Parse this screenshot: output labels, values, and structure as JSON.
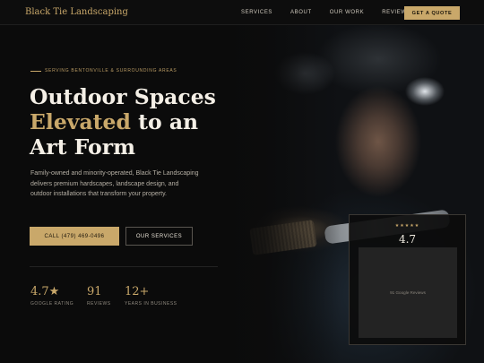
{
  "nav": {
    "brand": "Black Tie Landscaping",
    "links": [
      "SERVICES",
      "ABOUT",
      "OUR WORK",
      "REVIEWS"
    ],
    "cta": "GET A QUOTE"
  },
  "hero": {
    "eyebrow": "SERVING BENTONVILLE & SURROUNDING AREAS",
    "headline_line1": "Outdoor Spaces",
    "headline_gold": "Elevated",
    "headline_line2_rest": " to an",
    "headline_line3": "Art Form",
    "description": "Family-owned and minority-operated, Black Tie Landscaping delivers premium hardscapes, landscape design, and outdoor installations that transform your property.",
    "primary_button": "CALL (479) 469-0496",
    "secondary_button": "OUR SERVICES"
  },
  "stats": [
    {
      "value": "4.7★",
      "label": "GOOGLE RATING"
    },
    {
      "value": "91",
      "label": "REVIEWS"
    },
    {
      "value": "12+",
      "label": "YEARS IN BUSINESS"
    }
  ],
  "review_card": {
    "stars": "★★★★★",
    "rating": "4.7",
    "caption": "91 Google Reviews"
  },
  "colors": {
    "accent": "#c9a86a",
    "background": "#0b0b0b"
  }
}
